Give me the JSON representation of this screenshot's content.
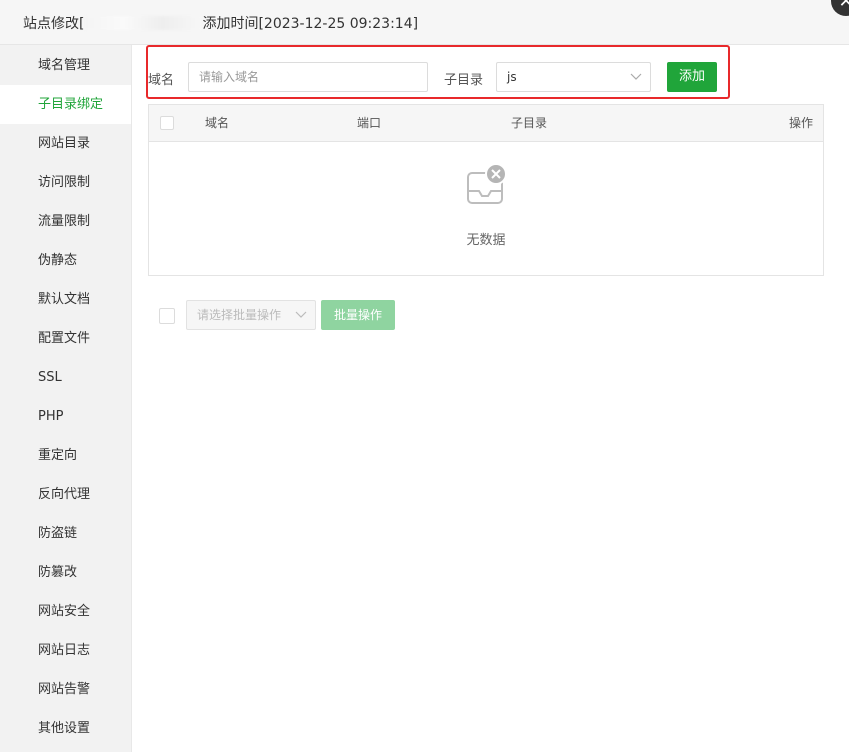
{
  "dialog": {
    "title_prefix": "站点修改[",
    "title_suffix": "添加时间[2023-12-25 09:23:14]",
    "close_glyph": "✕"
  },
  "sidebar": {
    "items": [
      {
        "label": "域名管理",
        "active": false
      },
      {
        "label": "子目录绑定",
        "active": true
      },
      {
        "label": "网站目录",
        "active": false
      },
      {
        "label": "访问限制",
        "active": false
      },
      {
        "label": "流量限制",
        "active": false
      },
      {
        "label": "伪静态",
        "active": false
      },
      {
        "label": "默认文档",
        "active": false
      },
      {
        "label": "配置文件",
        "active": false
      },
      {
        "label": "SSL",
        "active": false
      },
      {
        "label": "PHP",
        "active": false
      },
      {
        "label": "重定向",
        "active": false
      },
      {
        "label": "反向代理",
        "active": false
      },
      {
        "label": "防盗链",
        "active": false
      },
      {
        "label": "防篡改",
        "active": false
      },
      {
        "label": "网站安全",
        "active": false
      },
      {
        "label": "网站日志",
        "active": false
      },
      {
        "label": "网站告警",
        "active": false
      },
      {
        "label": "其他设置",
        "active": false
      }
    ]
  },
  "form": {
    "domain_label": "域名",
    "domain_placeholder": "请输入域名",
    "subdir_label": "子目录",
    "subdir_value": "js",
    "add_label": "添加"
  },
  "table": {
    "columns": [
      "域名",
      "端口",
      "子目录",
      "操作"
    ],
    "empty_text": "无数据"
  },
  "batch": {
    "select_placeholder": "请选择批量操作",
    "button_label": "批量操作"
  },
  "colors": {
    "accent": "#20a53a",
    "highlight": "#e8292b"
  }
}
